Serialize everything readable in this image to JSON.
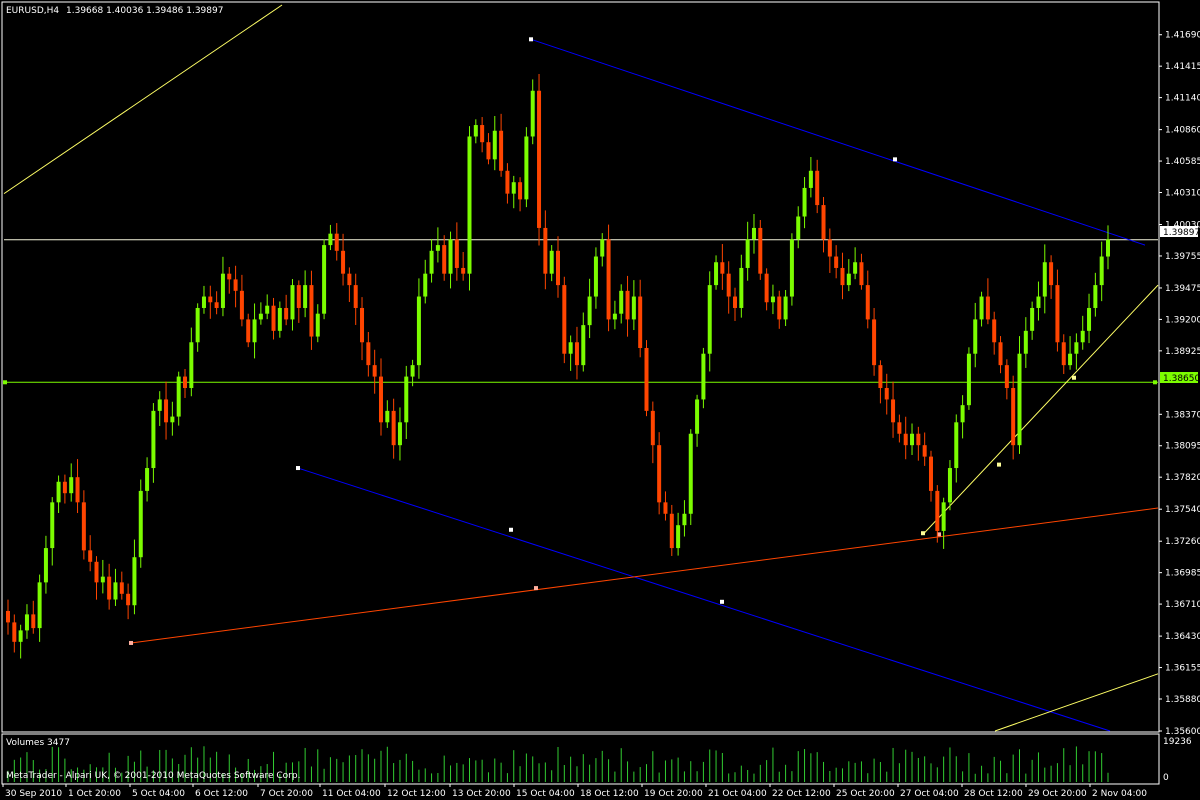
{
  "header": {
    "symbol": "EURUSD,H4",
    "ohlc": "1.39668 1.40036 1.39486 1.39897"
  },
  "volume_panel": {
    "label": "Volumes 3477",
    "max_label": "19236",
    "zero_label": "0"
  },
  "footer": {
    "copyright": "MetaTrader - Alpari UK, © 2001-2010 MetaQuotes Software Corp."
  },
  "colors": {
    "background": "#000000",
    "bull": "#7CFC00",
    "bear": "#FF4500",
    "trend_blue": "#0000FF",
    "trend_red": "#FF4500",
    "trend_yellow": "#FFFF66",
    "hline_current": "#F5F5DC",
    "hline_green": "#7CFC00",
    "volume": "#32CD32",
    "axis": "#FFFFFF"
  },
  "chart_data": {
    "type": "candlestick",
    "ylim": [
      1.356,
      1.4195
    ],
    "price_ticks": [
      "1.41690",
      "1.41415",
      "1.41140",
      "1.40860",
      "1.40585",
      "1.40310",
      "1.40030",
      "1.39755",
      "1.39475",
      "1.39200",
      "1.38925",
      "1.38370",
      "1.38095",
      "1.37820",
      "1.37540",
      "1.37260",
      "1.36985",
      "1.36710",
      "1.36430",
      "1.36155",
      "1.35880",
      "1.35600"
    ],
    "current_price_label": "1.39897",
    "current_price": 1.39897,
    "green_level_label": "1.38650",
    "green_level": 1.3865,
    "x_labels": [
      "30 Sep 2010",
      "1 Oct 20:00",
      "5 Oct 04:00",
      "6 Oct 12:00",
      "7 Oct 20:00",
      "11 Oct 04:00",
      "12 Oct 12:00",
      "13 Oct 20:00",
      "15 Oct 04:00",
      "18 Oct 12:00",
      "19 Oct 20:00",
      "21 Oct 04:00",
      "22 Oct 12:00",
      "25 Oct 20:00",
      "27 Oct 04:00",
      "28 Oct 12:00",
      "29 Oct 20:00",
      "2 Nov 04:00"
    ],
    "closes": [
      1.3655,
      1.3638,
      1.3648,
      1.3662,
      1.365,
      1.369,
      1.372,
      1.376,
      1.3778,
      1.3768,
      1.3782,
      1.376,
      1.3718,
      1.3708,
      1.369,
      1.3695,
      1.3675,
      1.369,
      1.368,
      1.367,
      1.3712,
      1.377,
      1.379,
      1.384,
      1.385,
      1.383,
      1.3835,
      1.387,
      1.386,
      1.39,
      1.393,
      1.394,
      1.3935,
      1.393,
      1.396,
      1.3955,
      1.3945,
      1.392,
      1.39,
      1.392,
      1.3925,
      1.3932,
      1.391,
      1.393,
      1.392,
      1.395,
      1.393,
      1.395,
      1.3905,
      1.3925,
      1.3985,
      1.3995,
      1.398,
      1.396,
      1.395,
      1.393,
      1.39,
      1.388,
      1.387,
      1.383,
      1.384,
      1.381,
      1.383,
      1.387,
      1.388,
      1.394,
      1.396,
      1.398,
      1.3985,
      1.396,
      1.399,
      1.3965,
      1.396,
      1.408,
      1.409,
      1.4075,
      1.406,
      1.4085,
      1.405,
      1.403,
      1.404,
      1.4025,
      1.408,
      1.412,
      1.4,
      1.396,
      1.398,
      1.395,
      1.389,
      1.39,
      1.388,
      1.3915,
      1.394,
      1.3975,
      1.399,
      1.392,
      1.3925,
      1.3945,
      1.392,
      1.394,
      1.3895,
      1.384,
      1.381,
      1.376,
      1.375,
      1.372,
      1.374,
      1.375,
      1.382,
      1.385,
      1.389,
      1.395,
      1.397,
      1.396,
      1.394,
      1.393,
      1.3965,
      1.399,
      1.4,
      1.396,
      1.3935,
      1.394,
      1.392,
      1.394,
      1.399,
      1.401,
      1.4035,
      1.405,
      1.402,
      1.399,
      1.3975,
      1.3965,
      1.395,
      1.396,
      1.397,
      1.395,
      1.392,
      1.388,
      1.386,
      1.385,
      1.383,
      1.382,
      1.381,
      1.382,
      1.381,
      1.38,
      1.377,
      1.3735,
      1.376,
      1.379,
      1.383,
      1.3845,
      1.389,
      1.392,
      1.394,
      1.392,
      1.39,
      1.388,
      1.386,
      1.381,
      1.389,
      1.391,
      1.393,
      1.394,
      1.397,
      1.395,
      1.39,
      1.388,
      1.389,
      1.39,
      1.391,
      1.393,
      1.395,
      1.3975,
      1.399
    ]
  }
}
